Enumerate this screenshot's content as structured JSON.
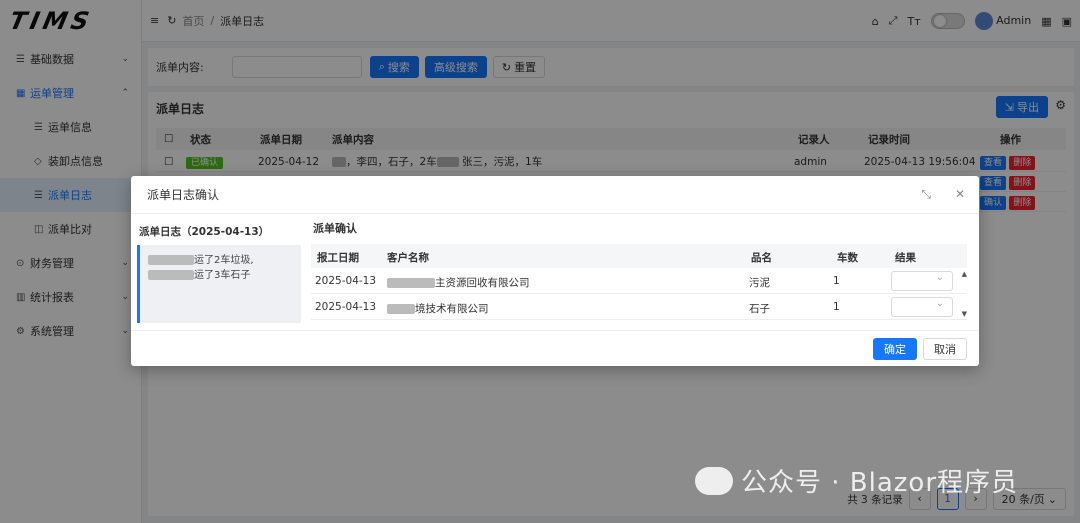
{
  "app": {
    "logo": "TIMS"
  },
  "sidebar": {
    "items": [
      {
        "label": "基础数据",
        "icon": "list-icon"
      },
      {
        "label": "运单管理",
        "icon": "grid-icon"
      },
      {
        "label": "运单信息"
      },
      {
        "label": "装卸点信息"
      },
      {
        "label": "派单日志"
      },
      {
        "label": "派单比对"
      },
      {
        "label": "财务管理",
        "icon": "dollar-icon"
      },
      {
        "label": "统计报表",
        "icon": "chart-icon"
      },
      {
        "label": "系统管理",
        "icon": "gear-icon"
      }
    ]
  },
  "topbar": {
    "home": "首页",
    "separator": "/",
    "current": "派单日志",
    "font_btn": "Tт",
    "user": "Admin"
  },
  "search": {
    "label": "派单内容:",
    "search_btn": "搜索",
    "advanced_btn": "高级搜索",
    "reset_btn": "重置"
  },
  "panel": {
    "title": "派单日志",
    "export_btn": "导出",
    "columns": [
      "状态",
      "派单日期",
      "派单内容",
      "记录人",
      "记录时间",
      "操作"
    ],
    "row1": {
      "status": "已确认",
      "date": "2025-04-12",
      "content_a": "，李四，石子，2车",
      "content_b": "张三，污泥，1车",
      "recorder": "admin",
      "time": "2025-04-13 19:56:04",
      "view": "查看",
      "delete": "删除"
    },
    "row2": {
      "view": "查看",
      "delete": "删除"
    },
    "row3": {
      "confirm": "确认",
      "delete": "删除"
    },
    "pager": {
      "total": "共 3 条记录",
      "page": "1",
      "size": "20 条/页"
    }
  },
  "modal": {
    "title": "派单日志确认",
    "left_title": "派单日志（2025-04-13）",
    "left_line1": "运了2车垃圾,",
    "left_line2": "运了3车石子",
    "right_title": "派单确认",
    "headers": [
      "报工日期",
      "客户名称",
      "品名",
      "车数",
      "结果"
    ],
    "rows": [
      {
        "date": "2025-04-13",
        "customer": "主资源回收有限公司",
        "product": "污泥",
        "count": "1"
      },
      {
        "date": "2025-04-13",
        "customer": "境技术有限公司",
        "product": "石子",
        "count": "1"
      }
    ],
    "ok": "确定",
    "cancel": "取消"
  },
  "watermark": {
    "text": "公众号 · Blazor程序员"
  }
}
